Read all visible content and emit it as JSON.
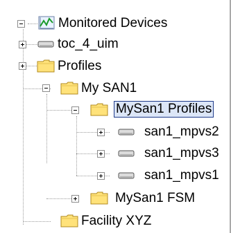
{
  "tree": {
    "root": {
      "label": "Monitored Devices",
      "icon": "monitor-chart-icon",
      "state": "expanded"
    },
    "items": [
      {
        "label": "toc_4_uim",
        "icon": "device-icon",
        "state": "collapsed"
      },
      {
        "label": "Profiles",
        "icon": "folder-icon",
        "state": "collapsed"
      },
      {
        "label": "My SAN1",
        "icon": "folder-icon",
        "state": "expanded"
      },
      {
        "label": "MySan1 Profiles",
        "icon": "folder-icon",
        "state": "expanded",
        "selected": true
      },
      {
        "label": "san1_mpvs2",
        "icon": "device-icon",
        "state": "collapsed"
      },
      {
        "label": "san1_mpvs3",
        "icon": "device-icon",
        "state": "collapsed"
      },
      {
        "label": "san1_mpvs1",
        "icon": "device-icon",
        "state": "collapsed"
      },
      {
        "label": "MySan1 FSM",
        "icon": "folder-icon",
        "state": "collapsed"
      },
      {
        "label": "Facility XYZ",
        "icon": "folder-icon",
        "state": "leaf"
      }
    ]
  },
  "colors": {
    "folder": "#ffe27a",
    "folder_outline": "#b08a1e",
    "selection_border": "#1f3b8a",
    "selection_bg": "#dce6f7",
    "chart_green": "#1a9a2a"
  }
}
